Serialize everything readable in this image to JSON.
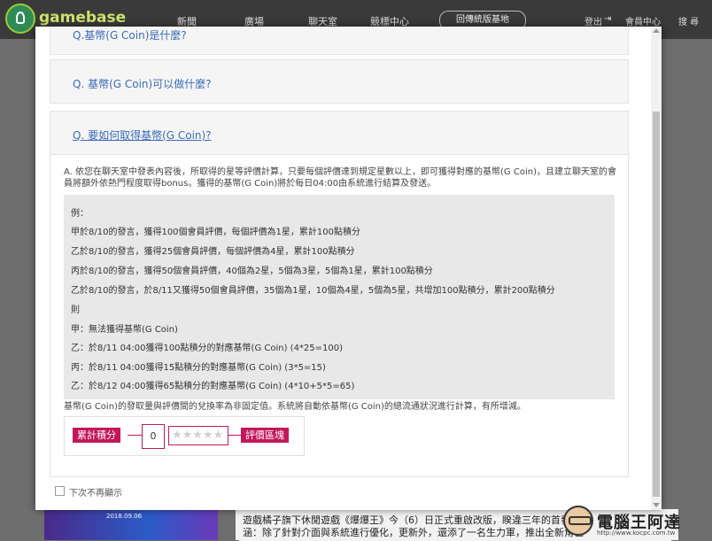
{
  "nav": {
    "logo": "gamebase",
    "items": [
      "新聞",
      "廣場",
      "聊天室",
      "競標中心"
    ],
    "pill": "回傳統版基地",
    "logout": "登出",
    "member": "會員中心",
    "search": "搜 尋"
  },
  "faq": [
    {
      "q": "Q.基幣(G Coin)是什麼?"
    },
    {
      "q": "Q. 基幣(G Coin)可以做什麼?"
    },
    {
      "q": "Q. 要如何取得基幣(G Coin)?"
    }
  ],
  "answer": {
    "text": "A. 依您在聊天室中發表內容後，所取得的星等評價計算，只要每個評價達到規定星數以上，即可獲得對應的基幣(G Coin)，且建立聊天室的會員將額外依熱門程度取得bonus。獲得的基幣(G Coin)將於每日04:00由系統進行結算及發送。",
    "example_lines": [
      "例：",
      "甲於8/10的發言，獲得100個會員評價，每個評價為1星，累計100點積分",
      "乙於8/10的發言，獲得25個會員評價，每個評價為4星，累計100點積分",
      "丙於8/10的發言，獲得50個會員評價，40個為2星，5個為3星，5個為1星，累計100點積分",
      "乙於8/10的發言，於8/11又獲得50個會員評價，35個為1星，10個為4星，5個為5星，共增加100點積分，累計200點積分",
      "則",
      "甲：無法獲得基幣(G Coin)",
      "乙：於8/11 04:00獲得100點積分的對應基幣(G Coin) (4*25=100)",
      "丙：於8/11 04:00獲得15點積分的對應基幣(G Coin) (3*5=15)",
      "乙：於8/12 04:00獲得65點積分的對應基幣(G Coin) (4*10+5*5=65)"
    ],
    "note": "基幣(G Coin)的發取量與評價間的兌換率為非固定值。系統將自動依基幣(G Coin)的總流通狀況進行計算，有所增減。"
  },
  "rating": {
    "points_label": "累計積分",
    "points_value": "0",
    "rating_label": "評價區塊",
    "stars": "★★★★★",
    "star_color": "#d0d0d0",
    "accent": "#c2185b"
  },
  "dont_show": "下次不再顯示",
  "backdrop": {
    "text": "遊戲橘子旗下休閒遊戲《爆爆王》今（6）日正式重啟改版，睽違三年的首發",
    "text2": "涵：除了針對介面與系統進行優化，更新外，還添了一名生力軍，推出全新角色",
    "banner": "2018.09.06"
  },
  "watermark": {
    "text": "電腦王阿達",
    "url": "http://www.kocpc.com.tw"
  }
}
